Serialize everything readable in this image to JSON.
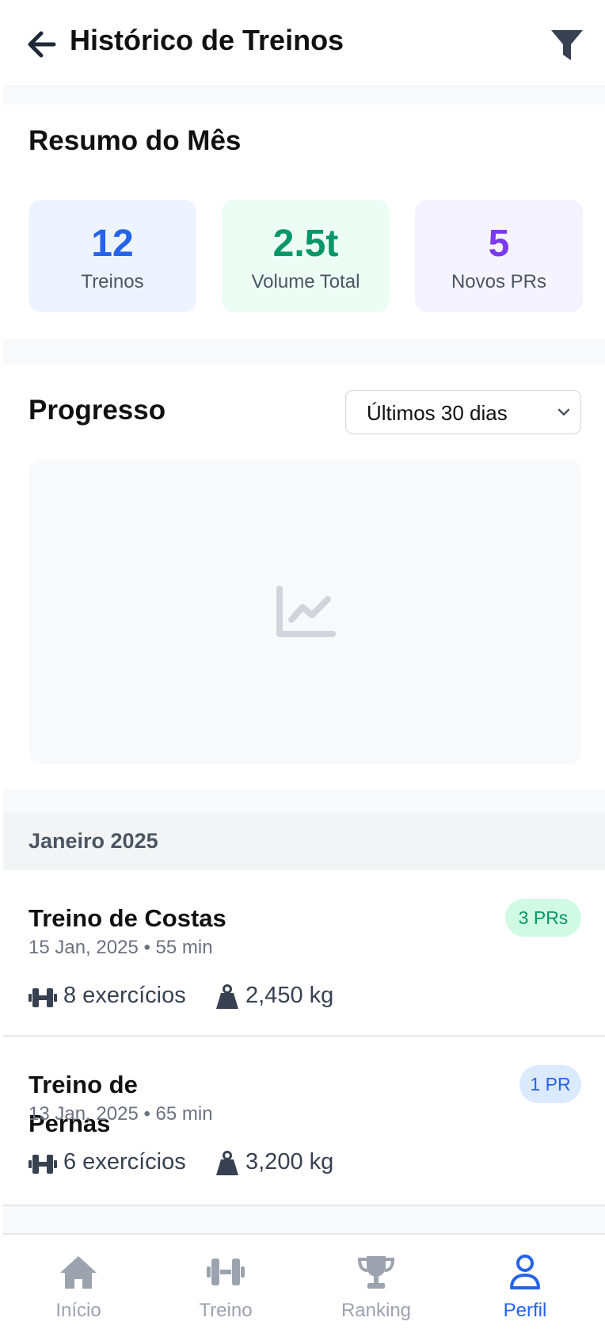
{
  "header": {
    "title": "Histórico de Treinos",
    "back_icon": "arrow-left-icon",
    "filter_icon": "filter-icon"
  },
  "summary": {
    "title": "Resumo do Mês",
    "stats": [
      {
        "value": "12",
        "label": "Treinos",
        "color": "#2563eb",
        "bg": "#eef4ff"
      },
      {
        "value": "2.5t",
        "label": "Volume Total",
        "color": "#059669",
        "bg": "#ecfdf5"
      },
      {
        "value": "5",
        "label": "Novos PRs",
        "color": "#7c3aed",
        "bg": "#f5f3ff"
      }
    ]
  },
  "progress": {
    "title": "Progresso",
    "range_select": "Últimos 30 dias",
    "chart_icon": "line-chart-icon"
  },
  "month_header": "Janeiro 2025",
  "workouts": [
    {
      "name": "Treino de Costas",
      "meta": "15 Jan, 2025 • 55 min",
      "badge": "3 PRs",
      "badge_color": "#059669",
      "badge_bg": "#d1fae5",
      "exercises": "8 exercícios",
      "volume": "2,450 kg"
    },
    {
      "name": "Treino de Pernas",
      "meta": "13 Jan, 2025 • 65 min",
      "badge": "1 PR",
      "badge_color": "#2563eb",
      "badge_bg": "#dbeafe",
      "exercises": "6 exercícios",
      "volume": "3,200 kg"
    }
  ],
  "nav": {
    "items": [
      {
        "label": "Início",
        "icon": "home-icon"
      },
      {
        "label": "Treino",
        "icon": "dumbbell-icon"
      },
      {
        "label": "Ranking",
        "icon": "trophy-icon"
      },
      {
        "label": "Perfil",
        "icon": "user-icon"
      }
    ],
    "active": "Perfil",
    "active_color": "#2563eb",
    "inactive_color": "#9ca3af"
  }
}
